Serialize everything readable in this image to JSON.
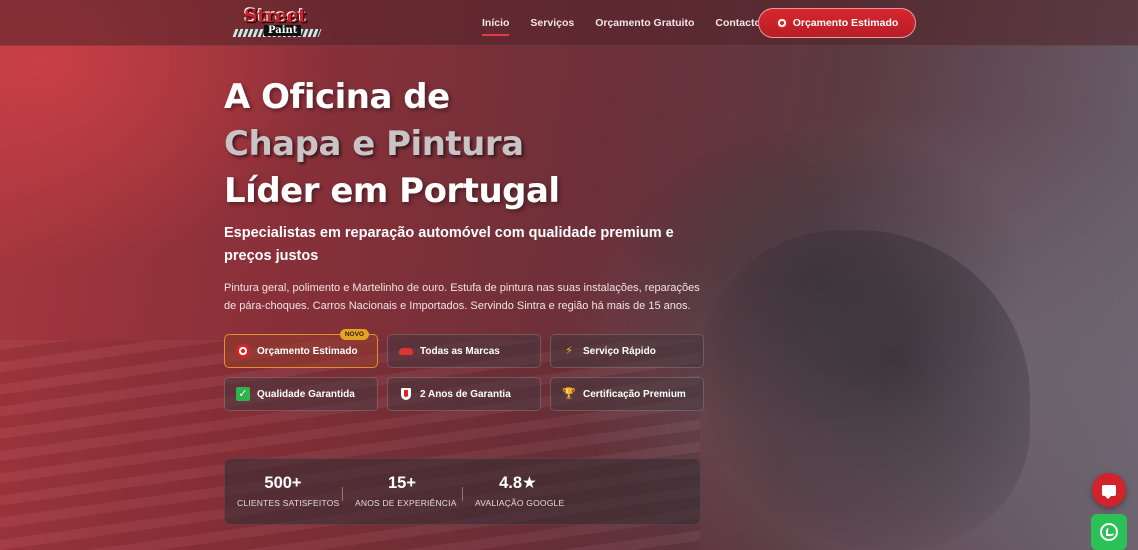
{
  "brand": {
    "logo_top": "Street",
    "logo_bottom": "Paint"
  },
  "nav": {
    "links": [
      "Início",
      "Serviços",
      "Orçamento Gratuito",
      "Contacto"
    ],
    "cta_label": "Orçamento Estimado"
  },
  "hero": {
    "title_line1": "A Oficina de",
    "title_line2": "Chapa e Pintura",
    "title_line3": "Líder em Portugal",
    "subtitle": "Especialistas em reparação automóvel com qualidade premium e preços justos",
    "description": "Pintura geral, polimento e Martelinho de ouro. Estufa de pintura nas suas instalações, reparações de pára-choques. Carros Nacionais e Importados. Servindo Sintra e região há mais de 15 anos."
  },
  "features": [
    {
      "label": "Orçamento Estimado",
      "icon": "target-icon",
      "badge": "NOVO"
    },
    {
      "label": "Todas as Marcas",
      "icon": "car-icon"
    },
    {
      "label": "Serviço Rápido",
      "icon": "lightning-icon"
    },
    {
      "label": "Qualidade Garantida",
      "icon": "check-icon"
    },
    {
      "label": "2 Anos de Garantia",
      "icon": "shield-icon"
    },
    {
      "label": "Certificação Premium",
      "icon": "trophy-icon"
    }
  ],
  "stats": [
    {
      "value": "500+",
      "label": "CLIENTES SATISFEITOS"
    },
    {
      "value": "15+",
      "label": "ANOS DE EXPERIÊNCIA"
    },
    {
      "value": "4.8★",
      "label": "AVALIAÇÃO GOOGLE"
    }
  ],
  "colors": {
    "accent": "#d0232c",
    "badge": "#e4a423",
    "whatsapp": "#2cc157"
  }
}
